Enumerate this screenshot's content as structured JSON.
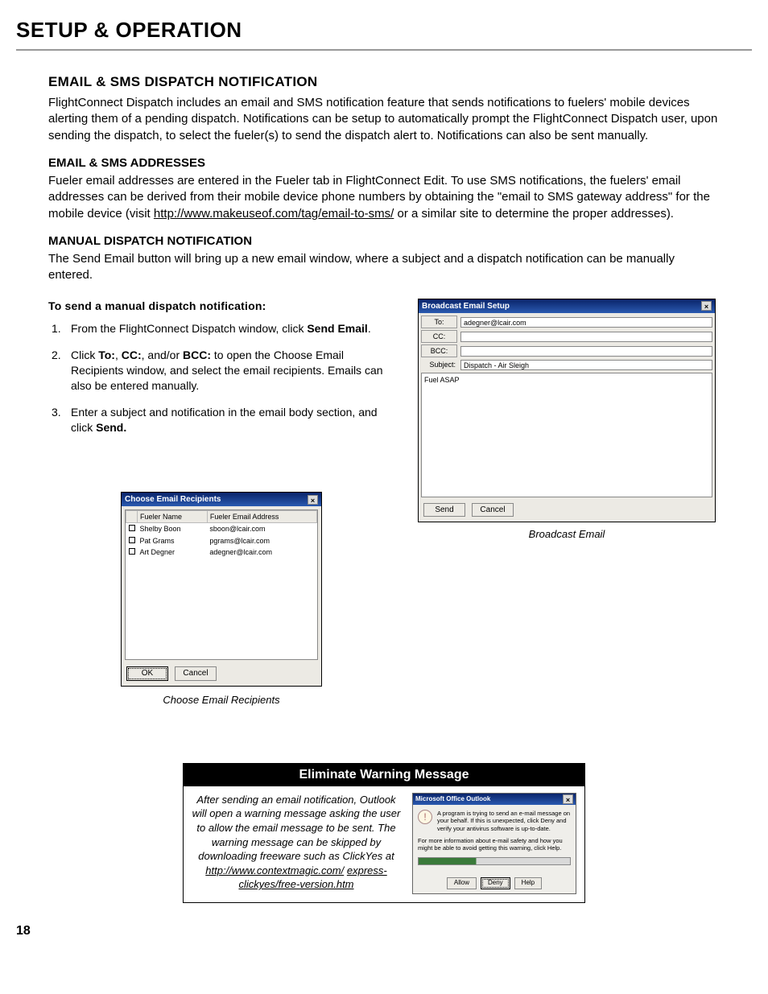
{
  "page": {
    "title": "SETUP & OPERATION",
    "number": "18"
  },
  "section": {
    "heading": "EMAIL & SMS DISPATCH NOTIFICATION",
    "intro": "FlightConnect Dispatch includes an email and SMS notification feature that sends notifications to fuelers' mobile devices alerting them of a pending dispatch. Notifications can be setup to automatically prompt the FlightConnect Dispatch user, upon sending the dispatch, to select the fueler(s) to send the dispatch alert to. Notifications can also be sent manually.",
    "addresses_heading": "EMAIL & SMS ADDRESSES",
    "addresses_body_pre": "Fueler email addresses are entered in the Fueler tab in FlightConnect Edit. To use SMS notifications, the fuelers' email addresses can be derived from their mobile device phone numbers by obtaining the \"email to SMS gateway address\" for the mobile device (visit ",
    "addresses_link": "http://www.makeuseof.com/tag/email-to-sms/",
    "addresses_body_post": " or a similar site to determine the proper addresses).",
    "manual_heading": "MANUAL DISPATCH NOTIFICATION",
    "manual_body": "The Send Email button will bring up a new email window, where a subject and a dispatch notification can be manually entered."
  },
  "task": {
    "heading": "To send a manual dispatch notification:",
    "step1_pre": "From the FlightConnect Dispatch window, click ",
    "step1_bold": "Send Email",
    "step1_post": ".",
    "step2_pre": "Click ",
    "step2_b1": "To:",
    "step2_mid1": ", ",
    "step2_b2": "CC:",
    "step2_mid2": ", and/or ",
    "step2_b3": "BCC:",
    "step2_post": " to open the Choose Email Recipients window, and select the email recipients. Emails can also be entered manually.",
    "step3_pre": "Enter a subject and notification in the email body section, and click ",
    "step3_bold": "Send.",
    "step3_post": ""
  },
  "choose_win": {
    "title": "Choose Email Recipients",
    "close": "×",
    "col_check": "",
    "col_name": "Fueler Name",
    "col_email": "Fueler Email Address",
    "rows": [
      {
        "name": "Shelby Boon",
        "email": "sboon@lcair.com"
      },
      {
        "name": "Pat Grams",
        "email": "pgrams@lcair.com"
      },
      {
        "name": "Art Degner",
        "email": "adegner@lcair.com"
      }
    ],
    "ok": "OK",
    "cancel": "Cancel",
    "caption": "Choose Email Recipients"
  },
  "broadcast_win": {
    "title": "Broadcast Email Setup",
    "close": "×",
    "to_label": "To:",
    "to_value": "adegner@lcair.com",
    "cc_label": "CC:",
    "cc_value": "",
    "bcc_label": "BCC:",
    "bcc_value": "",
    "subject_label": "Subject:",
    "subject_value": "Dispatch - Air Sleigh",
    "body": "Fuel ASAP",
    "send": "Send",
    "cancel": "Cancel",
    "caption": "Broadcast Email"
  },
  "warn": {
    "title": "Eliminate Warning Message",
    "text_pre": "After sending an email notification, Outlook will open a warning message asking the user to allow the email message to be sent. The warning message can be skipped by downloading freeware such as ClickYes at ",
    "link1": "http://www.contextmagic.com/",
    "link2": "express-clickyes/free-version.htm"
  },
  "outlook": {
    "title": "Microsoft Office Outlook",
    "close": "×",
    "line1": "A program is trying to send an e-mail message on your behalf. If this is unexpected, click Deny and verify your antivirus software is up-to-date.",
    "line2": "For more information about e-mail safety and how you might be able to avoid getting this warning, click Help.",
    "allow": "Allow",
    "deny": "Deny",
    "help": "Help"
  }
}
